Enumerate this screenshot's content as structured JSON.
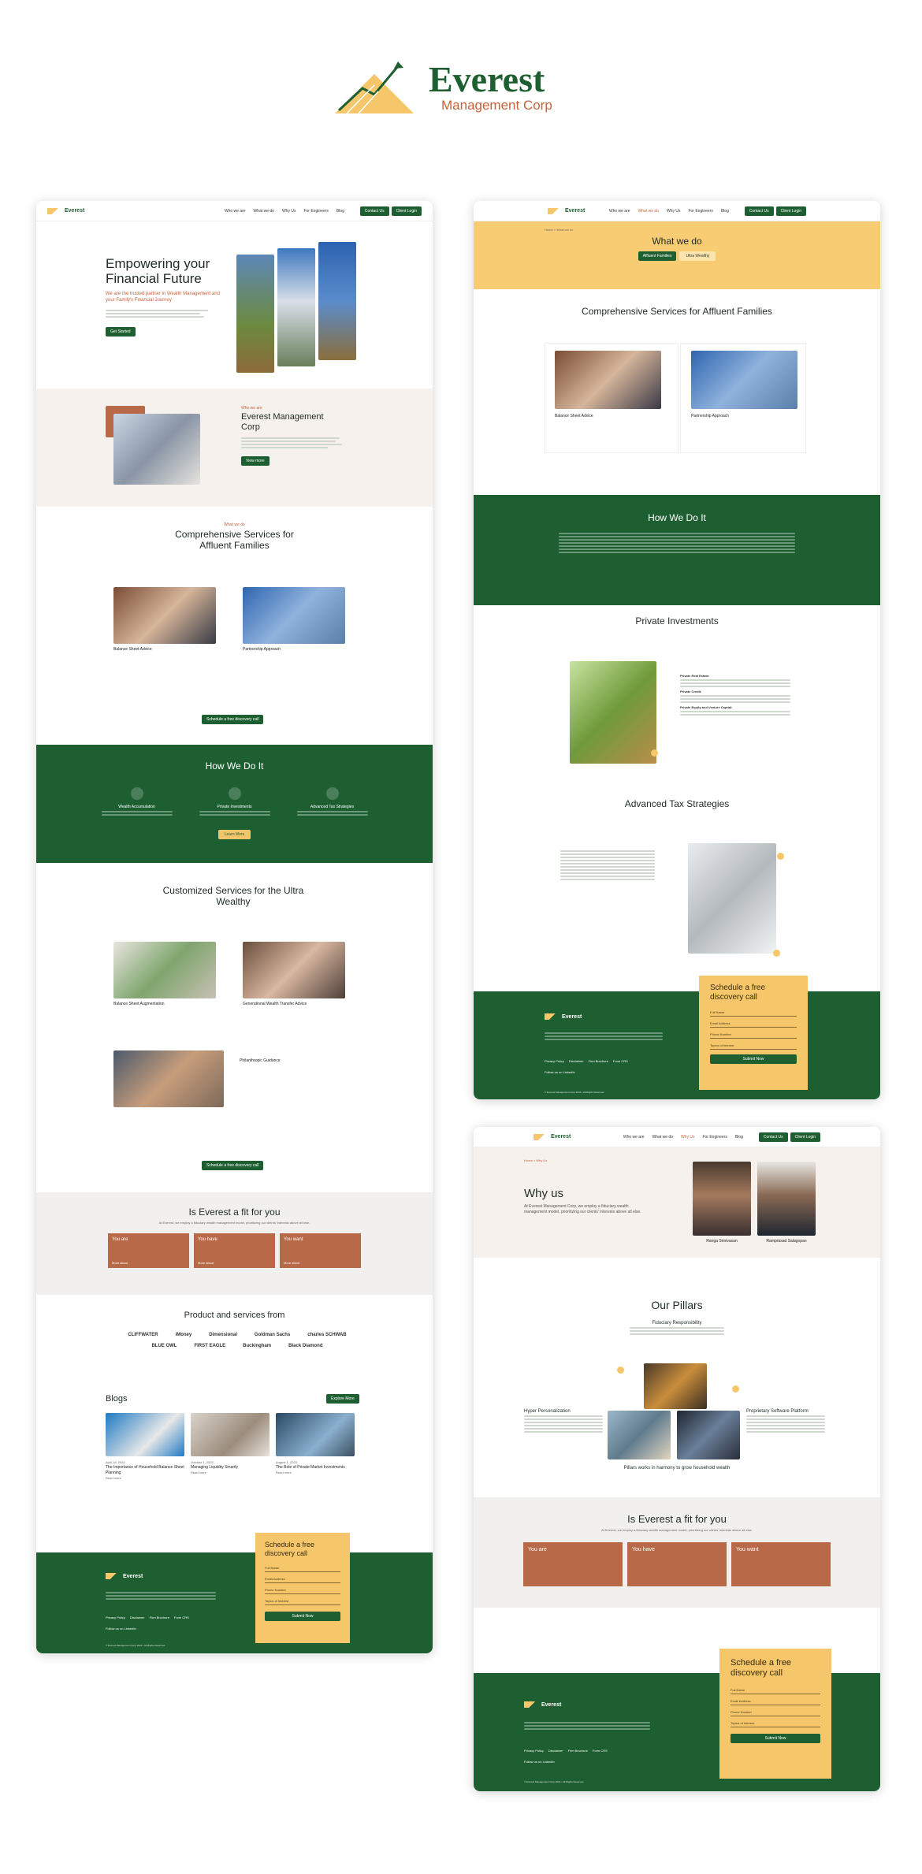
{
  "brand": {
    "name": "Everest",
    "sub": "Management Corp"
  },
  "nav": {
    "links": [
      "Who we are",
      "What we do",
      "Why Us",
      "For Engineers",
      "Blog"
    ],
    "contact": "Contact Us",
    "client": "Client Login"
  },
  "home": {
    "hero_title": "Empowering your Financial Future",
    "hero_sub": "We are the trusted partner in Wealth Management and your Family's Financial Journey",
    "hero_btn": "Get Started",
    "who_eyebrow": "Who we are",
    "who_title": "Everest Management Corp",
    "who_btn": "View more",
    "what_eyebrow": "What we do",
    "what_title": "Comprehensive Services for Affluent Families",
    "svc1": "Balance Sheet Advice",
    "svc2": "Partnership Approach",
    "sched_btn": "Schedule a free discovery call",
    "how_title": "How We Do It",
    "how_items": [
      "Wealth Accumulation",
      "Private Investments",
      "Advanced Tax Strategies"
    ],
    "learn_btn": "Learn More",
    "cust_title": "Customized Services for the Ultra Wealthy",
    "cust1": "Balance Sheet Augmentation",
    "cust2": "Generational Wealth Transfer Advice",
    "cust3": "Philanthropic Guidance",
    "fit_title": "Is Everest a fit for you",
    "fit_sub": "At Everest, we employ a fiduciary wealth management model, prioritizing our clients' interests above all else.",
    "fit_cards": [
      "You are",
      "You have",
      "You want"
    ],
    "fit_more": "More about",
    "prod_title": "Product and services from",
    "partners": [
      "CLIFFWATER",
      "iMoney",
      "Dimensional",
      "Goldman Sachs",
      "charles SCHWAB",
      "BLUE OWL",
      "FIRST EAGLE",
      "Buckingham",
      "Black Diamond"
    ],
    "blogs_title": "Blogs",
    "explore_btn": "Explore More",
    "blogs": [
      {
        "date": "April 18, 2024",
        "title": "The Importance of Household Balance Sheet Planning"
      },
      {
        "date": "October 1, 2023",
        "title": "Managing Liquidity Smartly"
      },
      {
        "date": "August 1, 2023",
        "title": "The Role of Private Market Investments"
      }
    ],
    "read_more": "Read more"
  },
  "what": {
    "breadcrumb": "Home > What we do",
    "title": "What we do",
    "tabs": [
      "Affluent Families",
      "Ultra Wealthy"
    ],
    "title2": "Comprehensive Services for Affluent Families",
    "svc1": "Balance Sheet Advice",
    "svc2": "Partnership Approach",
    "how_title": "How We Do It",
    "pi_title": "Private Investments",
    "pi_points": [
      "Private Real Estate:",
      "Private Credit:",
      "Private Equity and Venture Capital:"
    ],
    "ats_title": "Advanced Tax Strategies"
  },
  "why": {
    "breadcrumb": "Home > Why Us",
    "title": "Why us",
    "sub": "At Everest Management Corp, we employ a fiduciary wealth management model, prioritizing our clients' interests above all else.",
    "people": [
      "Ranga Srinivasan",
      "Ramprasad Salagopan"
    ],
    "pillars_title": "Our Pillars",
    "pillar_top": "Fiduciary Responsibility",
    "pillar_left": "Hyper Personalization",
    "pillar_right": "Proprietary Software Platform",
    "pillar_caption": "Pillars works in harmony to grow household wealth",
    "fit_title": "Is Everest a fit for you",
    "fit_sub": "At Everest, we employ a fiduciary wealth management model, prioritizing our clients' interests above all else.",
    "fit_cards": [
      "You are",
      "You have",
      "You want"
    ]
  },
  "footer": {
    "links": [
      "Privacy Policy",
      "Disclaimer",
      "Firm Brochure",
      "Form CRS"
    ],
    "linkedin": "Follow us on LinkedIn",
    "copyright": "© Everest Management Corp 2024 • All Rights Reserved",
    "form_title": "Schedule a free discovery call",
    "fields": [
      "Full Name",
      "Email Address",
      "Phone Number",
      "Topics of Interest"
    ],
    "submit": "Submit Now"
  },
  "colors": {
    "green": "#1e5f32",
    "yellow": "#f5c76a",
    "terracotta": "#b86a48",
    "orange": "#c8623a"
  }
}
